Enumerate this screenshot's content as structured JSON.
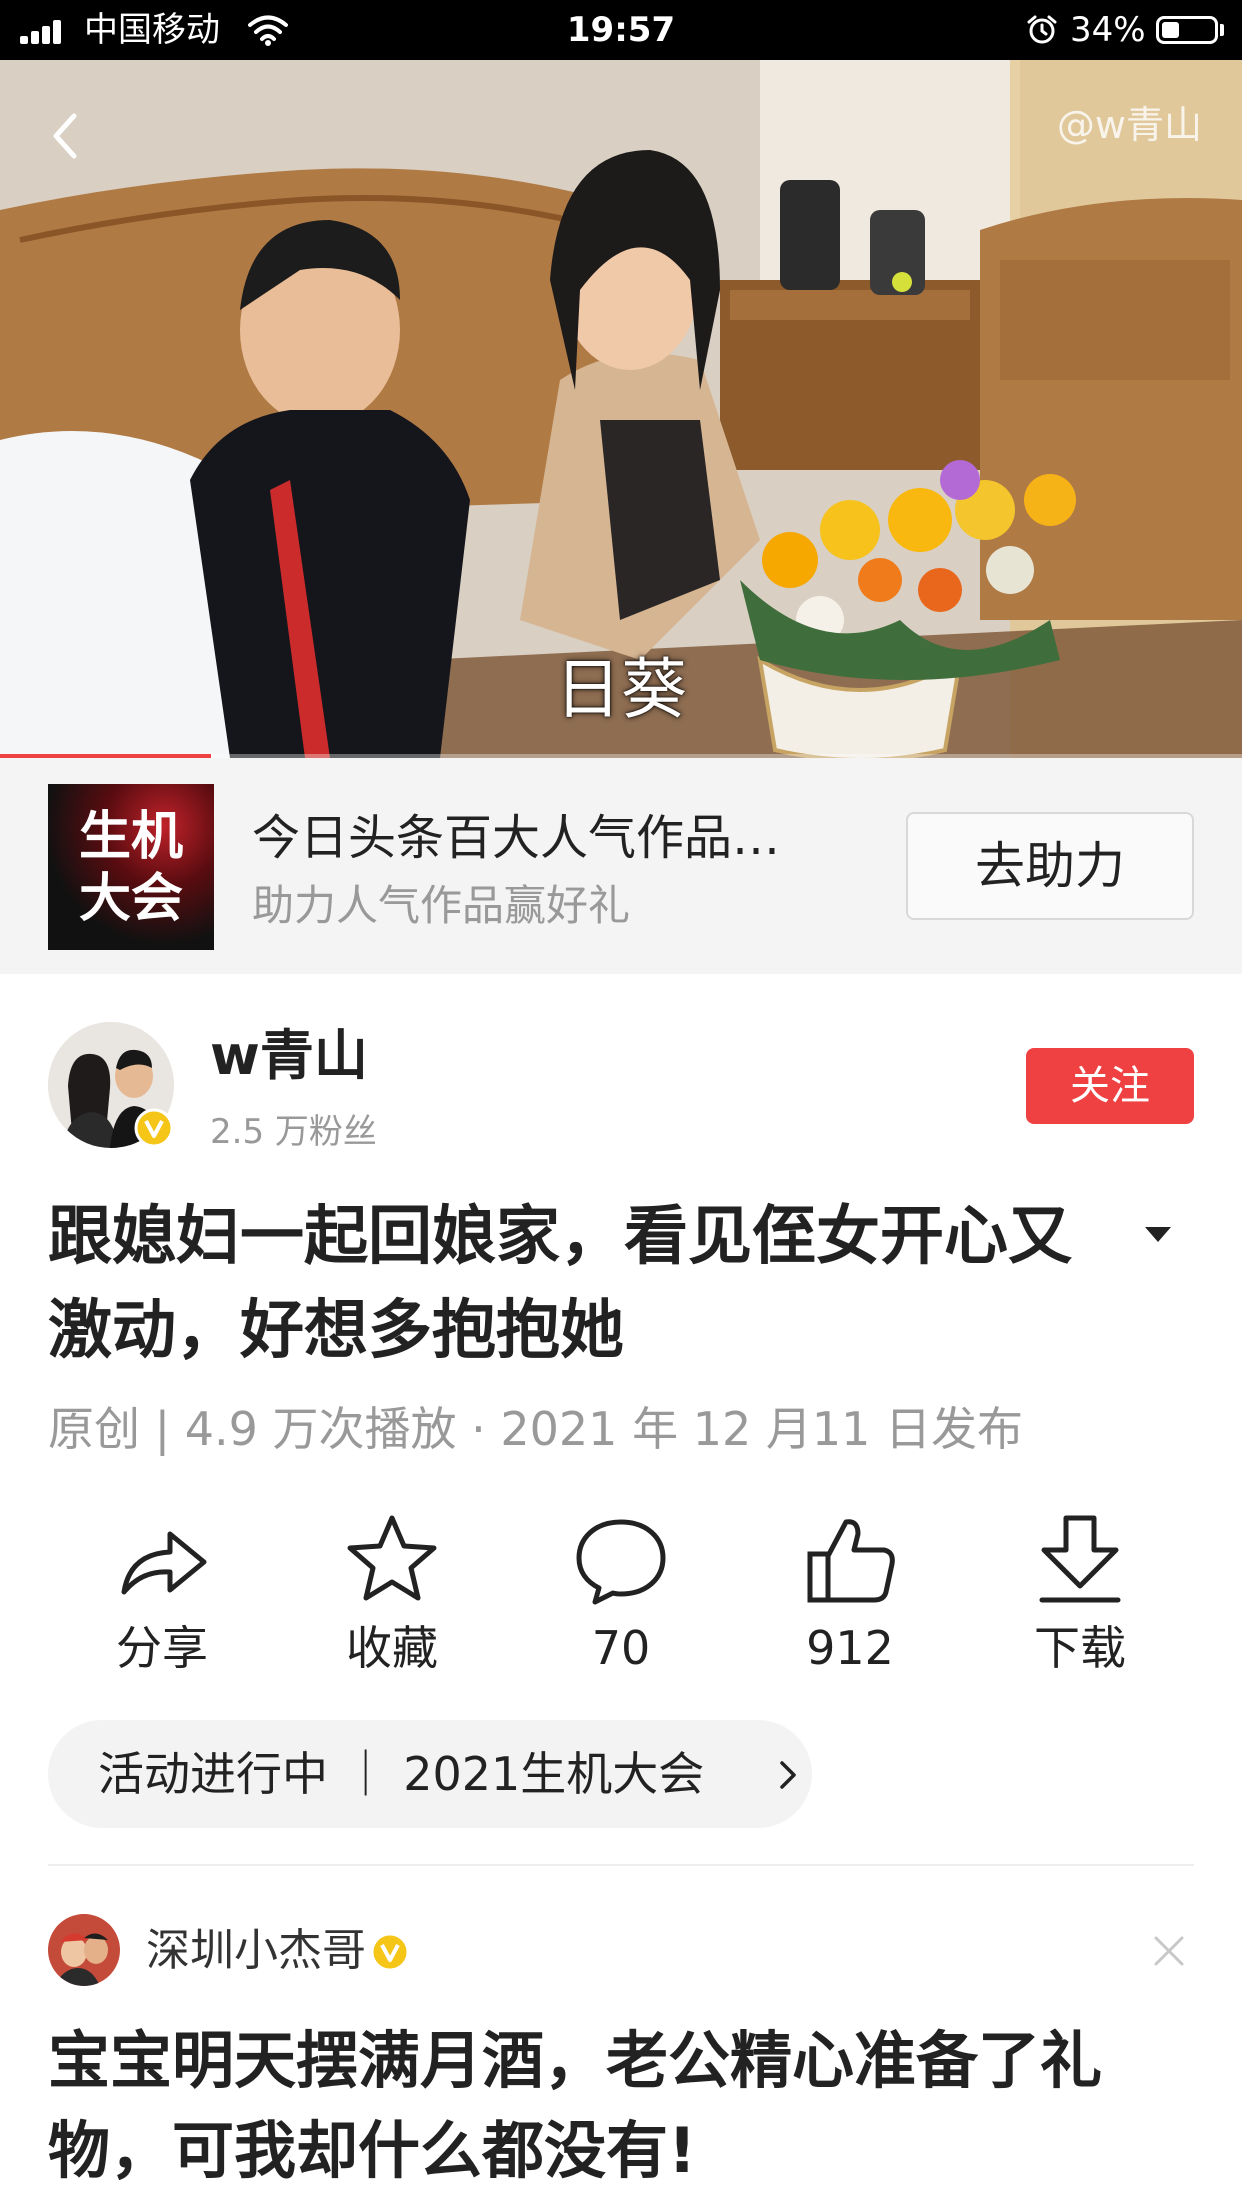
{
  "status_bar": {
    "carrier": "中国移动",
    "time": "19:57",
    "battery_percent": "34%",
    "battery_level": 0.34
  },
  "video": {
    "watermark": "@w青山",
    "subtitle": "日葵",
    "progress": 0.17
  },
  "promo": {
    "logo_line1": "生机",
    "logo_line2": "大会",
    "title": "今日头条百大人气作品…",
    "subtitle": "助力人气作品赢好礼",
    "button_label": "去助力"
  },
  "author": {
    "name": "w青山",
    "fans": "2.5 万粉丝",
    "follow_label": "关注"
  },
  "post": {
    "title": "跟媳妇一起回娘家，看见侄女开心又激动，好想多抱抱她",
    "meta": "原创 | 4.9 万次播放 · 2021 年 12 月11 日发布"
  },
  "actions": [
    {
      "icon": "share-icon",
      "label": "分享"
    },
    {
      "icon": "star-icon",
      "label": "收藏"
    },
    {
      "icon": "comment-icon",
      "label": "70"
    },
    {
      "icon": "thumbs-up-icon",
      "label": "912"
    },
    {
      "icon": "download-icon",
      "label": "下载"
    }
  ],
  "activity": {
    "text": "活动进行中 ｜ 2021生机大会"
  },
  "recommendation": {
    "author": "深圳小杰哥",
    "title": "宝宝明天摆满月酒，老公精心准备了礼物，可我却什么都没有!"
  },
  "colors": {
    "accent": "#f04142",
    "status_bar_bg": "#000000",
    "promo_bg": "#f4f4f4",
    "text_primary": "#222222",
    "text_secondary": "#999999",
    "verified_badge": "#f5c518"
  }
}
